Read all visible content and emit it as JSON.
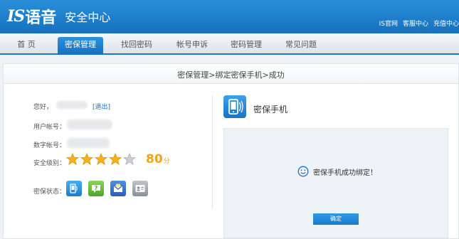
{
  "header": {
    "logo_is": "IS",
    "logo_cn": "语音",
    "subtitle": "安全中心",
    "links": [
      "IS官网",
      "客服中心",
      "充值中心"
    ]
  },
  "nav": {
    "items": [
      "首 页",
      "密保管理",
      "找回密码",
      "帐号申诉",
      "密码管理",
      "常见问题"
    ],
    "active_index": 1
  },
  "breadcrumb": "密保管理>绑定密保手机>成功",
  "account": {
    "greeting": "您好，",
    "logout": "[退出]",
    "user_account_label": "用户帐号：",
    "number_account_label": "数字帐号：",
    "security_level_label": "安全级别：",
    "security_stars": 4,
    "security_stars_max": 5,
    "security_score": "80",
    "security_score_unit": "分",
    "protection_status_label": "密保状态：",
    "status_icons": [
      "phone-shield-icon",
      "question-icon",
      "mail-icon",
      "id-card-icon"
    ]
  },
  "phone_section": {
    "title": "密保手机",
    "message": "密保手机成功绑定！",
    "confirm_label": "确定"
  },
  "colors": {
    "brand_blue": "#1d74c4",
    "score_orange": "#f0a514",
    "star_gold": "#f5b21a",
    "star_empty": "#c9ced4"
  }
}
